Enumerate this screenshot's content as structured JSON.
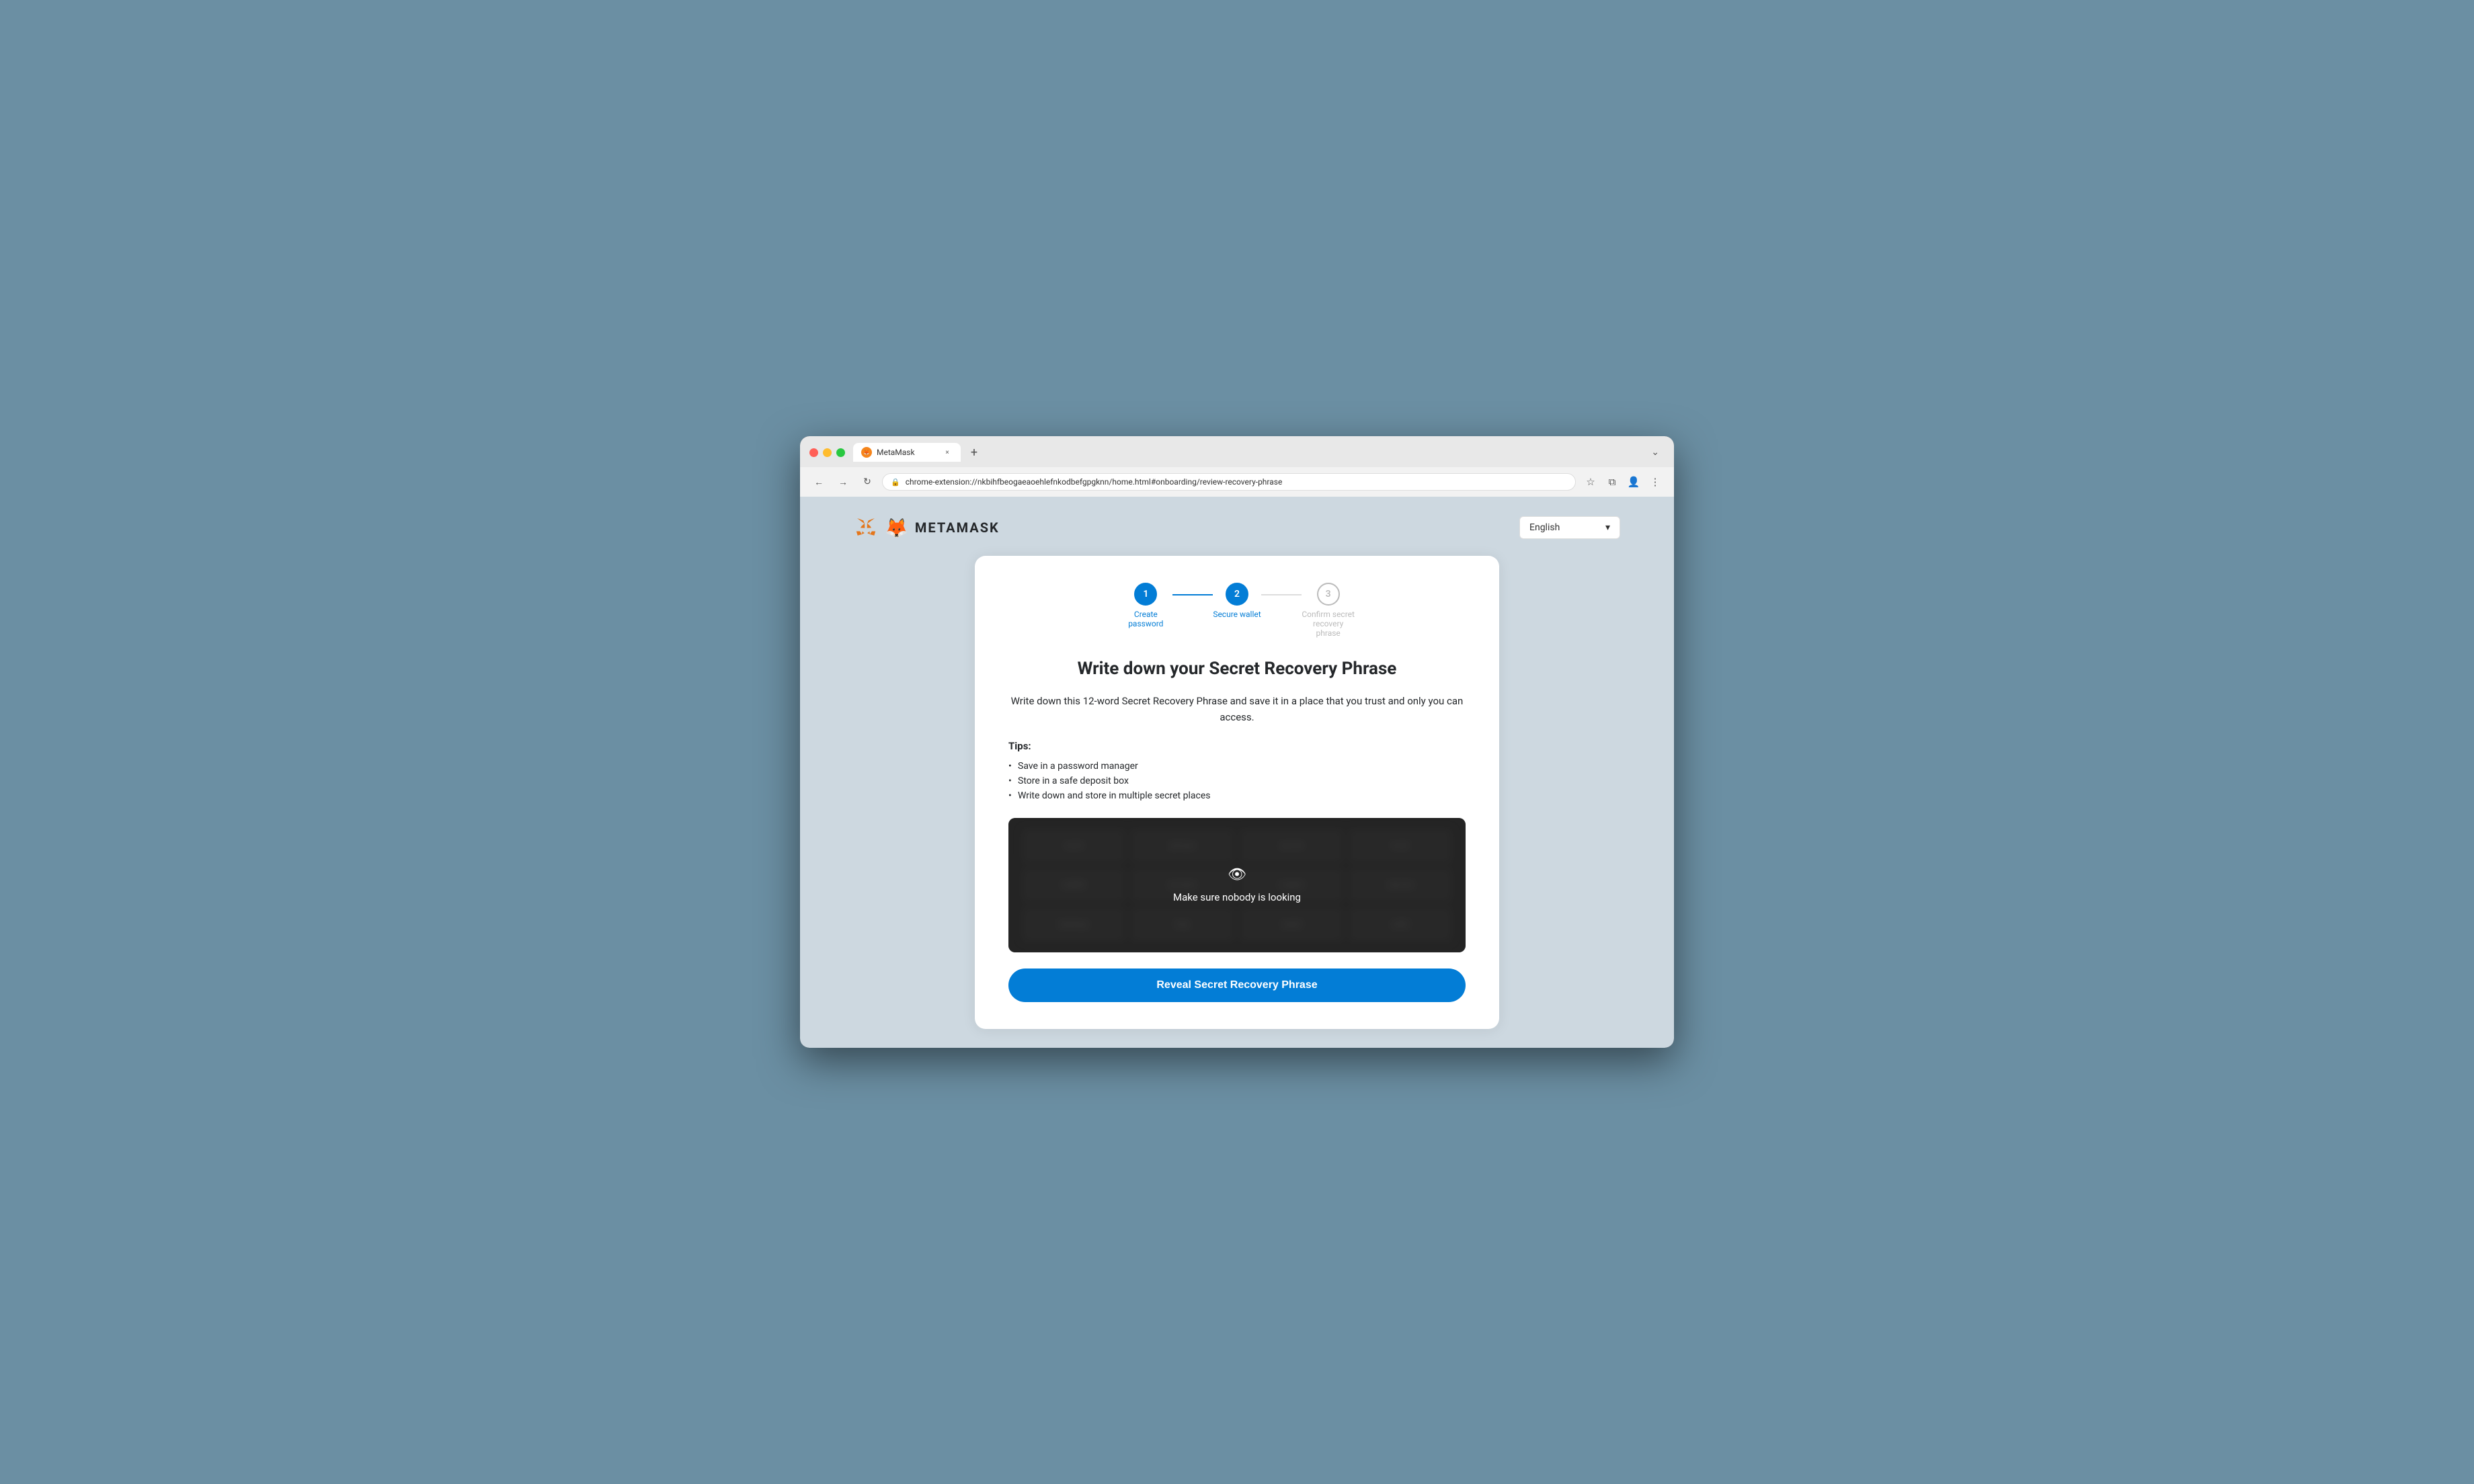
{
  "browser": {
    "tab_title": "MetaMask",
    "tab_close": "×",
    "new_tab": "+",
    "tab_more": "⌄",
    "nav_back": "←",
    "nav_forward": "→",
    "nav_refresh": "↻",
    "address_url": "chrome-extension://nkbihfbeogaeaoehlefnkodbefgpgknn/home.html#onboarding/review-recovery-phrase",
    "address_lock": "🔒",
    "nav_bookmark": "☆",
    "nav_extensions": "⧉",
    "nav_profile": "👤",
    "nav_more": "⋮"
  },
  "header": {
    "logo_text": "METAMASK",
    "language_selector": {
      "value": "English",
      "chevron": "▾"
    }
  },
  "progress": {
    "steps": [
      {
        "number": "1",
        "label": "Create password",
        "state": "completed"
      },
      {
        "number": "2",
        "label": "Secure wallet",
        "state": "active"
      },
      {
        "number": "3",
        "label": "Confirm secret recovery phrase",
        "state": "inactive"
      }
    ],
    "connector1_state": "active",
    "connector2_state": "inactive"
  },
  "main": {
    "title": "Write down your Secret Recovery Phrase",
    "description": "Write down this 12-word Secret Recovery Phrase and save it in a place that you trust and only you can access.",
    "tips": {
      "label": "Tips:",
      "items": [
        "Save in a password manager",
        "Store in a safe deposit box",
        "Write down and store in multiple secret places"
      ]
    },
    "blur_box": {
      "message": "Make sure nobody is looking",
      "eye_icon": "👁"
    },
    "reveal_button": "Reveal Secret Recovery Phrase"
  }
}
